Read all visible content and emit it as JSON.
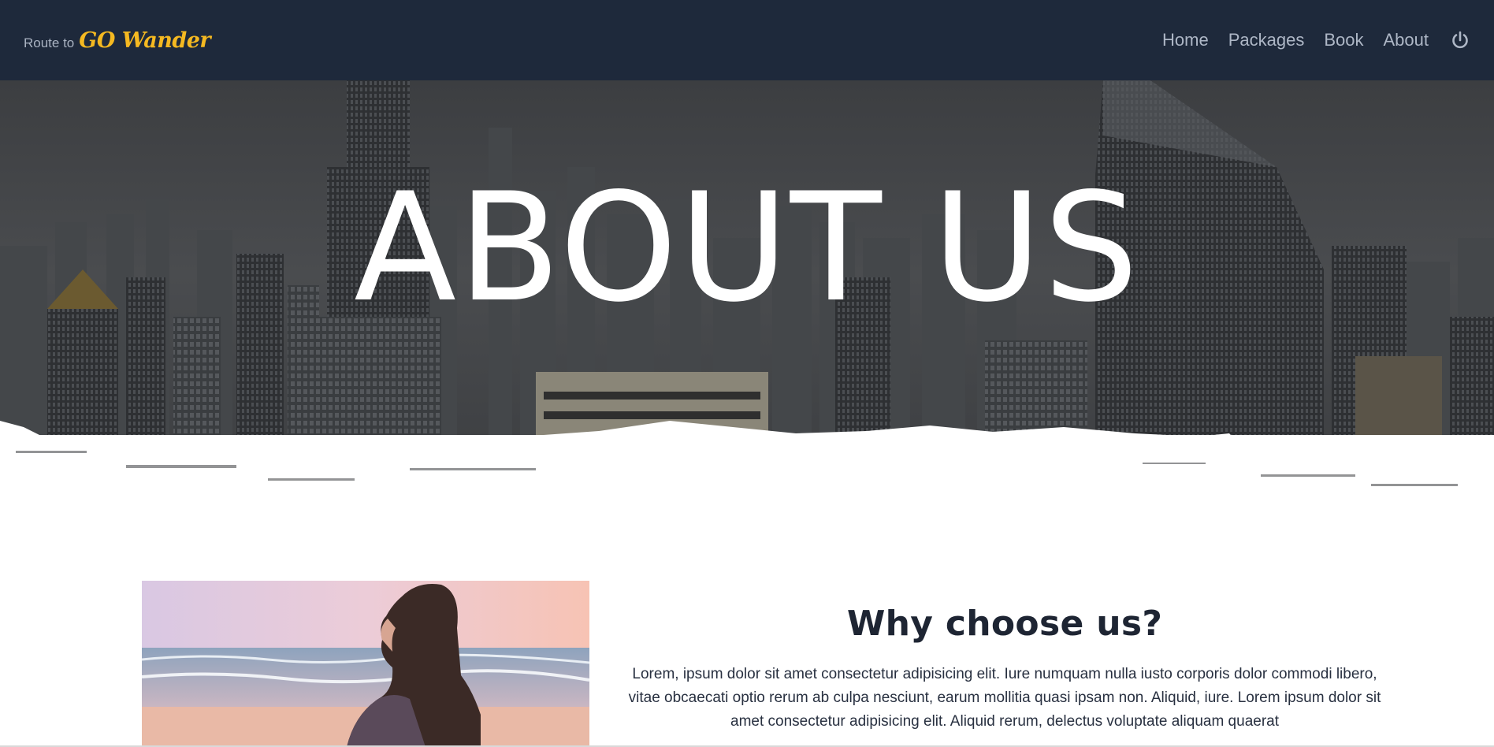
{
  "brand": {
    "prefix": "Route to",
    "name": "GO Wander"
  },
  "nav": {
    "items": [
      {
        "label": "Home"
      },
      {
        "label": "Packages"
      },
      {
        "label": "Book"
      },
      {
        "label": "About"
      }
    ],
    "power_icon": "power-icon"
  },
  "hero": {
    "title": "ABOUT US"
  },
  "why": {
    "title": "Why choose us?",
    "paragraph": "Lorem, ipsum dolor sit amet consectetur adipisicing elit. Iure numquam nulla iusto corporis dolor commodi libero, vitae obcaecati optio rerum ab culpa nesciunt, earum mollitia quasi ipsam non. Aliquid, iure. Lorem ipsum dolor sit amet consectetur adipisicing elit. Aliquid rerum, delectus voluptate aliquam quaerat"
  },
  "colors": {
    "navbar_bg": "#1e293b",
    "brand_accent": "#f5b921",
    "nav_text": "#aeb7c6",
    "hero_text": "#ffffff"
  }
}
